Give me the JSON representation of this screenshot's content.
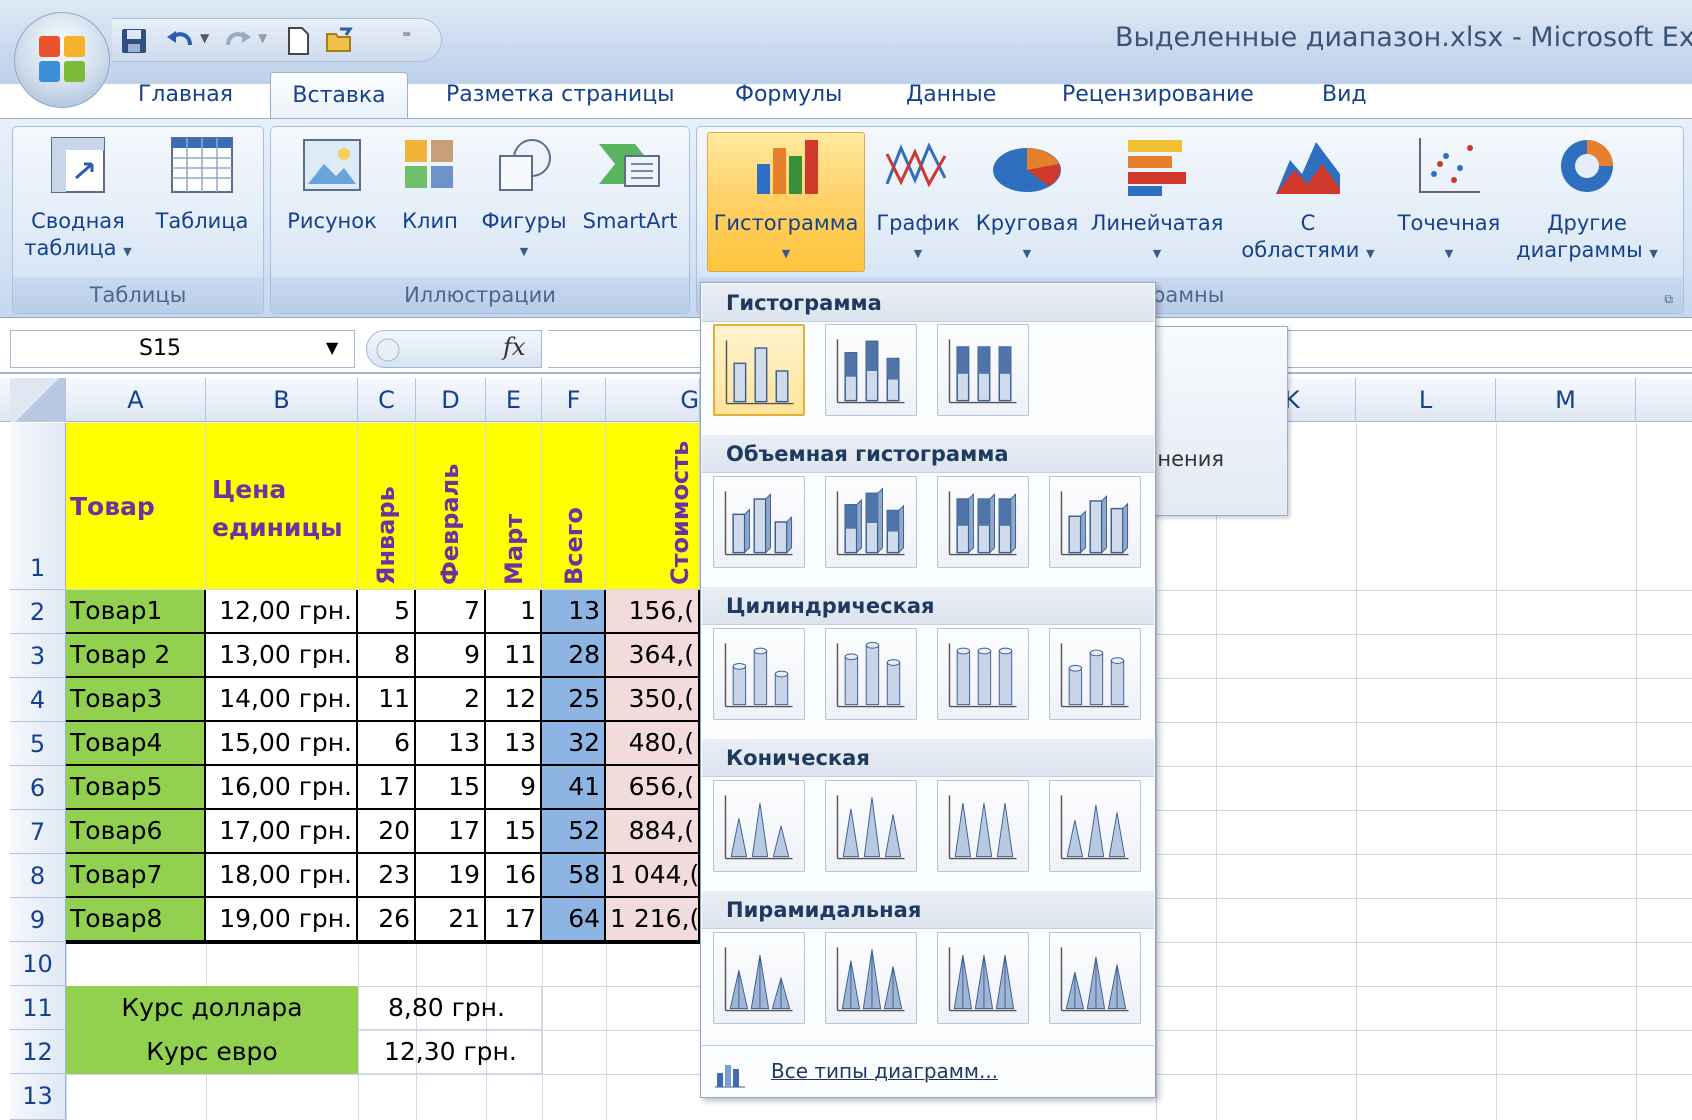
{
  "window": {
    "title": "Выделенные диапазон.xlsx - Microsoft Exce"
  },
  "quick_access": {
    "icons": [
      "save-icon",
      "undo-icon",
      "redo-icon",
      "new-icon",
      "open-icon",
      "customize-icon"
    ]
  },
  "tabs": [
    {
      "label": "Главная"
    },
    {
      "label": "Вставка",
      "active": true
    },
    {
      "label": "Разметка страницы"
    },
    {
      "label": "Формулы"
    },
    {
      "label": "Данные"
    },
    {
      "label": "Рецензирование"
    },
    {
      "label": "Вид"
    }
  ],
  "ribbon": {
    "tables": {
      "label": "Таблицы",
      "pivot": "Сводная",
      "pivot2": "таблица",
      "table": "Таблица"
    },
    "illustrations": {
      "label": "Иллюстрации",
      "picture": "Рисунок",
      "clip": "Клип",
      "shapes": "Фигуры",
      "smartart": "SmartArt"
    },
    "charts": {
      "label": "рамны",
      "column": "Гистограмма",
      "line": "График",
      "pie": "Круговая",
      "bar": "Линейчатая",
      "area1": "С",
      "area2": "областями",
      "scatter": "Точечная",
      "other1": "Другие",
      "other2": "диаграммы"
    }
  },
  "formula_bar": {
    "name_box": "S15",
    "fx": "fx"
  },
  "columns": [
    "A",
    "B",
    "C",
    "D",
    "E",
    "F",
    "G",
    "K",
    "L",
    "M"
  ],
  "rows": [
    "1",
    "2",
    "3",
    "4",
    "5",
    "6",
    "7",
    "8",
    "9",
    "10",
    "11",
    "12",
    "13"
  ],
  "table": {
    "headers": {
      "product": "Товар",
      "price1": "Цена",
      "price2": "единицы",
      "jan": "Январь",
      "feb": "Февраль",
      "mar": "Март",
      "total": "Всего",
      "cost": "Стоимость"
    },
    "data": [
      [
        "Товар1",
        "12,00 грн.",
        "5",
        "7",
        "1",
        "13",
        "156,("
      ],
      [
        "Товар 2",
        "13,00 грн.",
        "8",
        "9",
        "11",
        "28",
        "364,("
      ],
      [
        "Товар3",
        "14,00 грн.",
        "11",
        "2",
        "12",
        "25",
        "350,("
      ],
      [
        "Товар4",
        "15,00 грн.",
        "6",
        "13",
        "13",
        "32",
        "480,("
      ],
      [
        "Товар5",
        "16,00 грн.",
        "17",
        "15",
        "9",
        "41",
        "656,("
      ],
      [
        "Товар6",
        "17,00 грн.",
        "20",
        "17",
        "15",
        "52",
        "884,("
      ],
      [
        "Товар7",
        "18,00 грн.",
        "23",
        "19",
        "16",
        "58",
        "1 044,("
      ],
      [
        "Товар8",
        "19,00 грн.",
        "26",
        "21",
        "17",
        "64",
        "1 216,("
      ]
    ],
    "rates": [
      {
        "label": "Курс доллара",
        "value": "8,80 грн."
      },
      {
        "label": "Курс евро",
        "value": "12,30 грн."
      }
    ]
  },
  "dropdown": {
    "sections": [
      "Гистограмма",
      "Объемная гистограмма",
      "Цилиндрическая",
      "Коническая",
      "Пирамидальная"
    ],
    "all_types": "Все типы диаграмм..."
  },
  "tooltip": {
    "text": "внения"
  },
  "colors": {
    "yellow": "#ffff00",
    "green": "#92d050",
    "blue": "#8db4e2",
    "pink": "#f2dcdb",
    "purple": "#7030a0",
    "accent": "#ffc43c"
  }
}
